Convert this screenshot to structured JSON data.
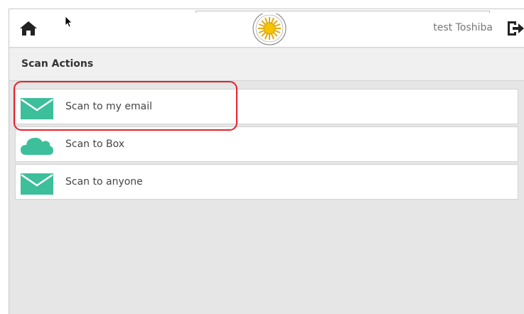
{
  "header": {
    "user_name": "test Toshiba",
    "logo_icon": "sun-seal-logo-icon",
    "home_icon": "home-icon",
    "logout_icon": "logout-icon"
  },
  "section": {
    "title": "Scan Actions"
  },
  "actions": [
    {
      "label": "Scan to my email",
      "icon": "envelope-icon",
      "highlighted": true
    },
    {
      "label": "Scan to Box",
      "icon": "cloud-icon",
      "highlighted": false
    },
    {
      "label": "Scan to anyone",
      "icon": "envelope-icon",
      "highlighted": false
    }
  ],
  "colors": {
    "icon_teal": "#3cbf9a",
    "highlight_red": "#e8202a",
    "background": "#e6e6e6"
  }
}
